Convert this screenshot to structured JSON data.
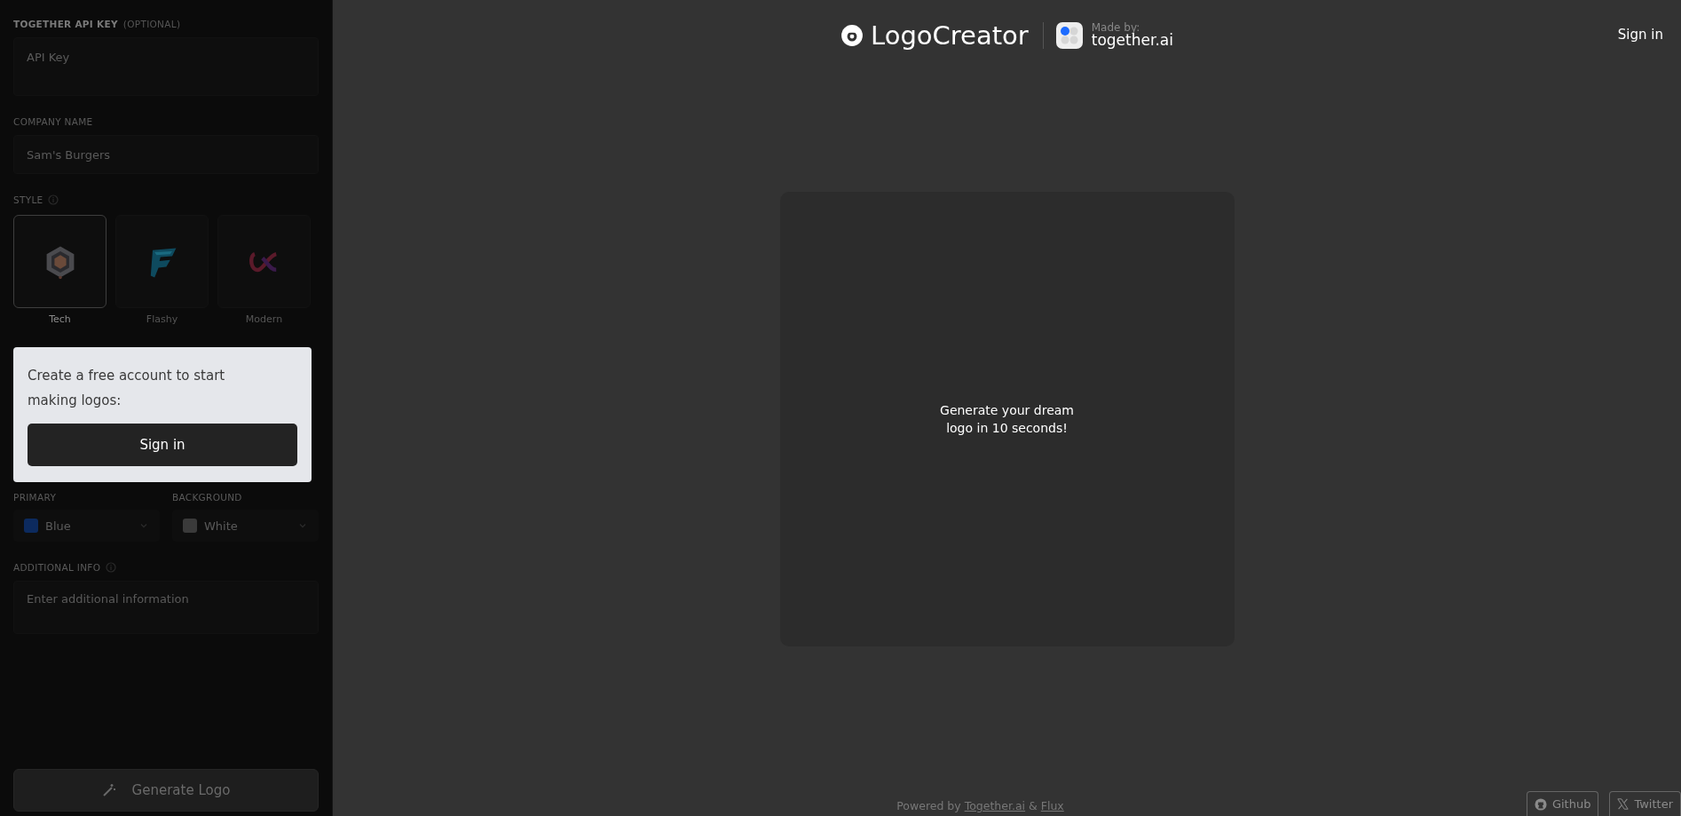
{
  "sidebar": {
    "api_key": {
      "label": "TOGETHER API KEY",
      "hint": "(OPTIONAL)",
      "placeholder": "API Key"
    },
    "company": {
      "label": "COMPANY NAME",
      "placeholder": "Sam's Burgers"
    },
    "style": {
      "label": "STYLE",
      "options": [
        {
          "label": "Tech",
          "selected": true,
          "kind": "tech"
        },
        {
          "label": "Flashy",
          "selected": false,
          "kind": "flashy"
        },
        {
          "label": "Modern",
          "selected": false,
          "kind": "modern"
        }
      ]
    },
    "colors": [
      {
        "label": "PRIMARY",
        "value": "Blue",
        "color": "#0c2a5e"
      },
      {
        "label": "BACKGROUND",
        "value": "White",
        "color": "#3a3a3a"
      }
    ],
    "additional": {
      "label": "ADDITIONAL INFO",
      "placeholder": "Enter additional information"
    },
    "generate_button": "Generate Logo",
    "signin_popup": {
      "message": "Create a free account to start making logos:",
      "button": "Sign in"
    }
  },
  "header": {
    "brand": "LogoCreator",
    "made_by": "Made by:",
    "maker": "together",
    "maker_suffix": ".ai",
    "sign_in": "Sign in"
  },
  "preview": {
    "message": "Generate your dream logo in 10 seconds!"
  },
  "footer": {
    "powered_by": "Powered by",
    "link_1": "Together.ai",
    "separator": "&",
    "link_2": "Flux",
    "buttons": [
      {
        "label": "Github",
        "kind": "github"
      },
      {
        "label": "Twitter",
        "kind": "x"
      }
    ]
  }
}
